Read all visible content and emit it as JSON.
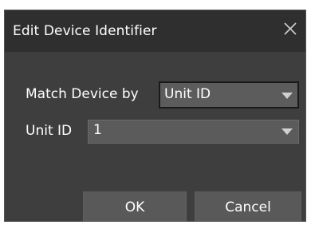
{
  "dialog": {
    "title": "Edit Device Identifier",
    "close_icon": "close-icon"
  },
  "form": {
    "match_label": "Match Device by",
    "match_value": "Unit ID",
    "unit_label": "Unit ID",
    "unit_value": "1"
  },
  "buttons": {
    "ok_label": "OK",
    "cancel_label": "Cancel"
  },
  "colors": {
    "titlebar": "#2f2f2f",
    "body": "#3e3e3e",
    "control": "#5b5b5b",
    "text": "#ffffff"
  }
}
